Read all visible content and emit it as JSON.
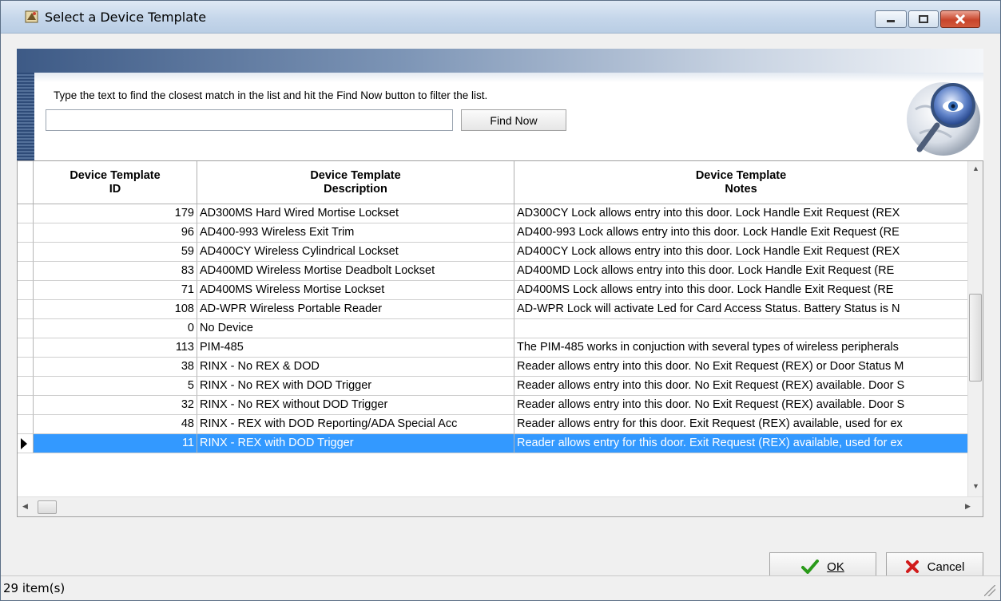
{
  "window": {
    "title": "Select a Device Template",
    "controls": [
      "minimize",
      "maximize",
      "close"
    ]
  },
  "search": {
    "hint": "Type the text to find the closest match in the list and hit the Find Now button to filter the list.",
    "value": "",
    "placeholder": "",
    "find_button_label": "Find Now"
  },
  "grid": {
    "columns": [
      {
        "key": "id",
        "label": "Device Template\nID"
      },
      {
        "key": "description",
        "label": "Device Template\nDescription"
      },
      {
        "key": "notes",
        "label": "Device Template\nNotes"
      }
    ],
    "rows": [
      {
        "id": "179",
        "description": "AD300MS Hard Wired Mortise Lockset",
        "notes": "AD300CY Lock allows entry into this door. Lock Handle Exit Request (REX",
        "selected": false
      },
      {
        "id": "96",
        "description": "AD400-993 Wireless Exit Trim",
        "notes": "AD400-993 Lock allows entry into this door. Lock Handle Exit Request (RE",
        "selected": false
      },
      {
        "id": "59",
        "description": "AD400CY Wireless Cylindrical Lockset",
        "notes": "AD400CY Lock allows entry into this door. Lock Handle Exit Request (REX",
        "selected": false
      },
      {
        "id": "83",
        "description": "AD400MD Wireless Mortise Deadbolt Lockset",
        "notes": "AD400MD Lock allows entry into this door. Lock Handle Exit Request (RE",
        "selected": false
      },
      {
        "id": "71",
        "description": "AD400MS Wireless Mortise Lockset",
        "notes": "AD400MS Lock allows entry into this door. Lock Handle Exit Request (RE",
        "selected": false
      },
      {
        "id": "108",
        "description": "AD-WPR Wireless Portable Reader",
        "notes": "AD-WPR Lock will activate Led for Card Access Status. Battery Status is N",
        "selected": false
      },
      {
        "id": "0",
        "description": "No Device",
        "notes": "",
        "selected": false
      },
      {
        "id": "113",
        "description": "PIM-485",
        "notes": "The PIM-485 works in conjuction with several types of wireless peripherals",
        "selected": false
      },
      {
        "id": "38",
        "description": "RINX - No REX & DOD",
        "notes": "Reader allows entry into this door. No Exit Request (REX) or Door Status M",
        "selected": false
      },
      {
        "id": "5",
        "description": "RINX - No REX with DOD Trigger",
        "notes": "Reader allows entry into this door. No Exit Request (REX) available. Door S",
        "selected": false
      },
      {
        "id": "32",
        "description": "RINX - No REX without DOD Trigger",
        "notes": "Reader allows entry into this door. No Exit Request (REX) available. Door S",
        "selected": false
      },
      {
        "id": "48",
        "description": "RINX - REX with DOD Reporting/ADA Special Acc",
        "notes": "Reader allows entry for this door. Exit Request (REX) available, used for ex",
        "selected": false
      },
      {
        "id": "11",
        "description": "RINX - REX with DOD Trigger",
        "notes": "Reader allows entry for this door. Exit Request (REX) available, used for ex",
        "selected": true
      }
    ]
  },
  "buttons": {
    "ok_label": "OK",
    "cancel_label": "Cancel"
  },
  "status": {
    "item_count": "29 item(s)"
  },
  "colors": {
    "selection": "#3399ff",
    "ok_check": "#2a9a1a",
    "cancel_x": "#d11b1b"
  },
  "icons": [
    "app-icon",
    "magnifier-globe-icon",
    "checkmark-icon",
    "x-icon",
    "row-pointer-icon",
    "resize-grip-icon"
  ]
}
